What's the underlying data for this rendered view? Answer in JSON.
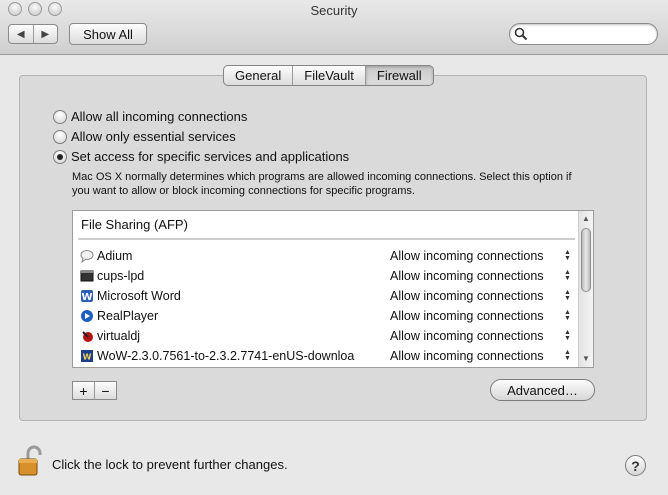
{
  "window": {
    "title": "Security"
  },
  "toolbar": {
    "back_glyph": "◀",
    "forward_glyph": "▶",
    "show_all_label": "Show All",
    "search_placeholder": ""
  },
  "tabs": [
    {
      "label": "General",
      "active": false
    },
    {
      "label": "FileVault",
      "active": false
    },
    {
      "label": "Firewall",
      "active": true
    }
  ],
  "firewall": {
    "options": [
      {
        "label": "Allow all incoming connections",
        "selected": false
      },
      {
        "label": "Allow only essential services",
        "selected": false
      },
      {
        "label": "Set access for specific services and applications",
        "selected": true
      }
    ],
    "description": "Mac OS X normally determines which programs are allowed incoming connections. Select this option if you want to allow or block incoming connections for specific programs.",
    "list_header": "File Sharing (AFP)",
    "apps": [
      {
        "name": "Adium",
        "permission": "Allow incoming connections",
        "icon": "adium-icon"
      },
      {
        "name": "cups-lpd",
        "permission": "Allow incoming connections",
        "icon": "terminal-icon"
      },
      {
        "name": "Microsoft Word",
        "permission": "Allow incoming connections",
        "icon": "word-icon"
      },
      {
        "name": "RealPlayer",
        "permission": "Allow incoming connections",
        "icon": "realplayer-icon"
      },
      {
        "name": "virtualdj",
        "permission": "Allow incoming connections",
        "icon": "virtualdj-icon"
      },
      {
        "name": "WoW-2.3.0.7561-to-2.3.2.7741-enUS-downloa",
        "permission": "Allow incoming connections",
        "icon": "wow-icon"
      }
    ],
    "add_label": "+",
    "remove_label": "−",
    "advanced_label": "Advanced…"
  },
  "footer": {
    "lock_text": "Click the lock to prevent further changes.",
    "help_label": "?"
  },
  "colors": {
    "window_bg": "#e8e8e8",
    "panel_bg": "#dadada",
    "list_bg": "#ffffff"
  }
}
